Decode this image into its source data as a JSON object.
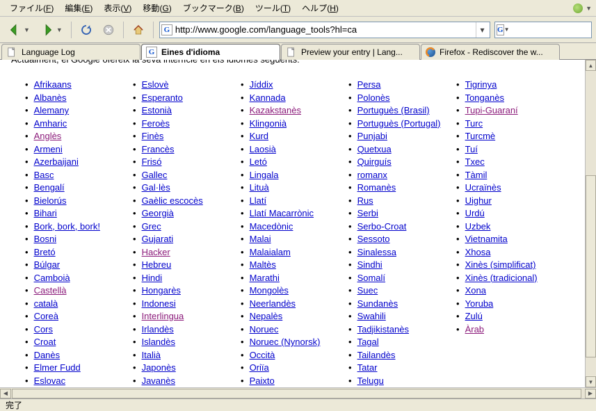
{
  "menu": {
    "file": {
      "label": "ファイル",
      "accel": "F"
    },
    "edit": {
      "label": "編集",
      "accel": "E"
    },
    "view": {
      "label": "表示",
      "accel": "V"
    },
    "go": {
      "label": "移動",
      "accel": "G"
    },
    "bookmark": {
      "label": "ブックマーク",
      "accel": "B"
    },
    "tools": {
      "label": "ツール",
      "accel": "T"
    },
    "help": {
      "label": "ヘルプ",
      "accel": "H"
    }
  },
  "url": "http://www.google.com/language_tools?hl=ca",
  "tabs": [
    {
      "label": "Language Log"
    },
    {
      "label": "Eines d'idioma"
    },
    {
      "label": "Preview your entry | Lang..."
    },
    {
      "label": "Firefox - Rediscover the w..."
    }
  ],
  "pretext": "Actualment, el Google ofereix la seva interfície en els idiomes següents:",
  "status": "完了",
  "columns": [
    [
      {
        "t": "Afrikaans"
      },
      {
        "t": "Albanès"
      },
      {
        "t": "Alemany"
      },
      {
        "t": "Amharic"
      },
      {
        "t": "Anglès",
        "v": 1
      },
      {
        "t": "Armeni"
      },
      {
        "t": "Azerbaijani"
      },
      {
        "t": "Basc"
      },
      {
        "t": "Bengalí"
      },
      {
        "t": "Bielorús"
      },
      {
        "t": "Bihari"
      },
      {
        "t": "Bork, bork, bork!"
      },
      {
        "t": "Bosni"
      },
      {
        "t": "Bretó"
      },
      {
        "t": "Búlgar"
      },
      {
        "t": "Camboià"
      },
      {
        "t": "Castellà",
        "v": 1
      },
      {
        "t": "català"
      },
      {
        "t": "Coreà"
      },
      {
        "t": "Cors"
      },
      {
        "t": "Croat"
      },
      {
        "t": "Danès"
      },
      {
        "t": "Elmer Fudd"
      },
      {
        "t": "Eslovac"
      }
    ],
    [
      {
        "t": "Eslovè"
      },
      {
        "t": "Esperanto"
      },
      {
        "t": "Estonià"
      },
      {
        "t": "Feroès"
      },
      {
        "t": "Finès"
      },
      {
        "t": "Francès"
      },
      {
        "t": "Frisó"
      },
      {
        "t": "Gallec"
      },
      {
        "t": "Gal·lès"
      },
      {
        "t": "Gaèlic escocès"
      },
      {
        "t": "Georgià"
      },
      {
        "t": "Grec"
      },
      {
        "t": "Gujarati"
      },
      {
        "t": "Hacker",
        "v": 1
      },
      {
        "t": "Hebreu"
      },
      {
        "t": "Hindi"
      },
      {
        "t": "Hongarès"
      },
      {
        "t": "Indonesi"
      },
      {
        "t": "Interlingua",
        "v": 1
      },
      {
        "t": "Irlandès"
      },
      {
        "t": "Islandès"
      },
      {
        "t": "Italià"
      },
      {
        "t": "Japonès"
      },
      {
        "t": "Javanès"
      }
    ],
    [
      {
        "t": "Jíddix"
      },
      {
        "t": "Kannada"
      },
      {
        "t": "Kazakstanès",
        "v": 1
      },
      {
        "t": "Klingonià"
      },
      {
        "t": "Kurd"
      },
      {
        "t": "Laosià"
      },
      {
        "t": "Letó"
      },
      {
        "t": "Lingala"
      },
      {
        "t": "Lituà"
      },
      {
        "t": "Llatí"
      },
      {
        "t": "Llatí Macarrònic"
      },
      {
        "t": "Macedònic"
      },
      {
        "t": "Malai"
      },
      {
        "t": "Malaialam"
      },
      {
        "t": "Maltès"
      },
      {
        "t": "Marathi"
      },
      {
        "t": "Mongolès"
      },
      {
        "t": "Neerlandès"
      },
      {
        "t": "Nepalès"
      },
      {
        "t": "Noruec"
      },
      {
        "t": "Noruec (Nynorsk)"
      },
      {
        "t": "Occità"
      },
      {
        "t": "Oriïa"
      },
      {
        "t": "Paixto"
      }
    ],
    [
      {
        "t": "Persa"
      },
      {
        "t": "Polonès"
      },
      {
        "t": "Portuguès (Brasil)"
      },
      {
        "t": "Portuguès (Portugal)"
      },
      {
        "t": "Punjabi"
      },
      {
        "t": "Quetxua"
      },
      {
        "t": "Quirguís"
      },
      {
        "t": "romanx"
      },
      {
        "t": "Romanès"
      },
      {
        "t": "Rus"
      },
      {
        "t": "Serbi"
      },
      {
        "t": "Serbo-Croat"
      },
      {
        "t": "Sessoto"
      },
      {
        "t": "Sinalessa"
      },
      {
        "t": "Sindhi"
      },
      {
        "t": "Somalí"
      },
      {
        "t": "Suec"
      },
      {
        "t": "Sundanès"
      },
      {
        "t": "Swahili"
      },
      {
        "t": "Tadjikistanès"
      },
      {
        "t": "Tagal"
      },
      {
        "t": "Tailandès"
      },
      {
        "t": "Tatar"
      },
      {
        "t": "Telugu"
      }
    ],
    [
      {
        "t": "Tigrinya"
      },
      {
        "t": "Tonganès"
      },
      {
        "t": "Tupi-Guaraní",
        "v": 1
      },
      {
        "t": "Turc"
      },
      {
        "t": "Turcmè"
      },
      {
        "t": "Tuí"
      },
      {
        "t": "Txec"
      },
      {
        "t": "Tàmil"
      },
      {
        "t": "Ucraïnès"
      },
      {
        "t": "Uighur"
      },
      {
        "t": "Urdú"
      },
      {
        "t": "Uzbek"
      },
      {
        "t": "Vietnamita"
      },
      {
        "t": "Xhosa"
      },
      {
        "t": "Xinès (simplificat)"
      },
      {
        "t": "Xinès (tradicional)"
      },
      {
        "t": "Xona"
      },
      {
        "t": "Yoruba"
      },
      {
        "t": "Zulú"
      },
      {
        "t": "Àrab",
        "v": 1
      }
    ]
  ]
}
